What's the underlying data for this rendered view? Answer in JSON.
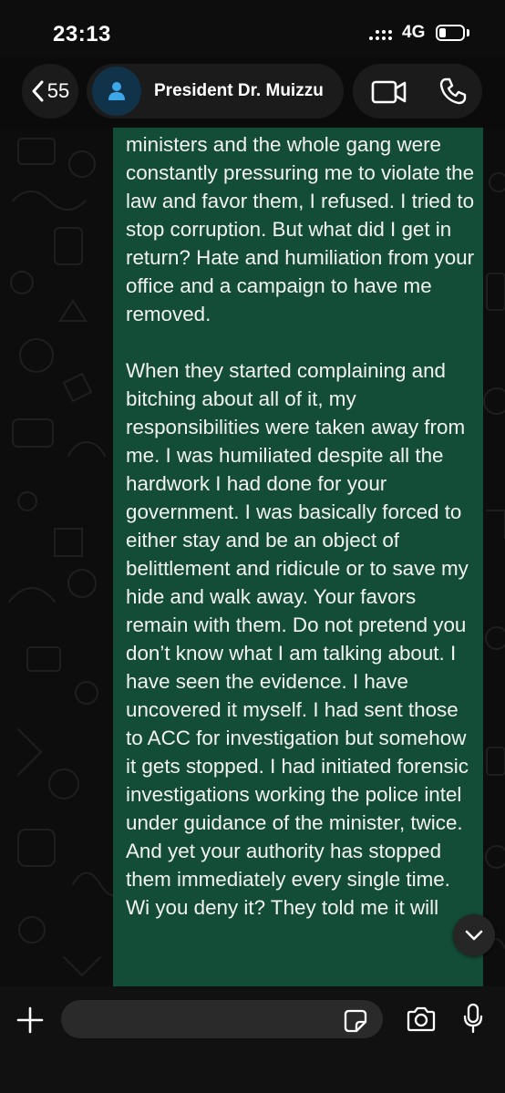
{
  "status_bar": {
    "time": "23:13",
    "network": "4G"
  },
  "header": {
    "back_count": "55",
    "contact_name": "President Dr. Muizzu"
  },
  "message": {
    "paragraph_1": "ministers and the whole gang were constantly pressuring me to violate the law and favor them, I refused. I tried to stop corruption. But what did I get in return? Hate and humiliation from your office and a campaign to have me removed.",
    "paragraph_2": "When they started complaining and bitching about all of it, my responsibilities were taken away from me. I was humiliated despite all the hardwork I had done for your government. I was basically forced to either stay and be an object of belittlement and ridicule or to save my hide and walk away. Your favors remain with them. Do not pretend you don’t know what I am talking about. I have seen the evidence. I have uncovered it myself. I had sent those to ACC for investigation but somehow it gets stopped. I had initiated forensic investigations working the police intel under guidance of the minister, twice. And yet your authority has stopped them immediately every single time. Wi you deny it? They told me it will"
  },
  "input": {
    "value": "",
    "placeholder": ""
  },
  "colors": {
    "bubble": "#144d37",
    "background": "#0d0d0d",
    "avatar": "#10334a"
  },
  "icons": [
    "signal-icon",
    "battery-icon",
    "back-chevron-icon",
    "person-icon",
    "video-call-icon",
    "phone-call-icon",
    "scroll-down-icon",
    "plus-icon",
    "sticker-icon",
    "camera-icon",
    "microphone-icon"
  ]
}
